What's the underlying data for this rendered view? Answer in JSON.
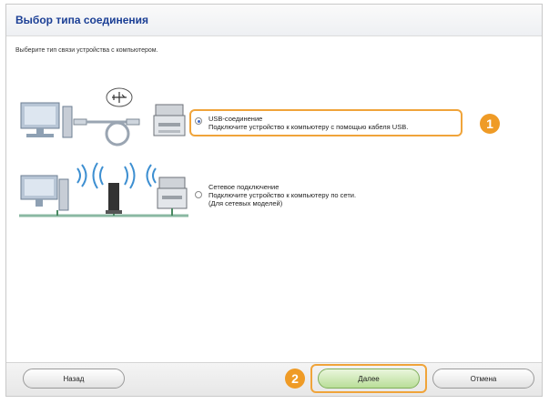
{
  "dialog": {
    "title": "Выбор типа соединения",
    "instruction": "Выберите тип связи устройства с компьютером."
  },
  "options": [
    {
      "title": "USB-соединение",
      "description": "Подключите устройство к компьютеру с помощью кабеля USB.",
      "selected": true,
      "illustration_icon": "computer-usb-printer-icon"
    },
    {
      "title": "Сетевое подключение",
      "description": "Подключите устройство к компьютеру по сети.",
      "note": "(Для сетевых моделей)",
      "selected": false,
      "illustration_icon": "network-wifi-printer-icon"
    }
  ],
  "callouts": [
    "1",
    "2"
  ],
  "buttons": {
    "back": "Назад",
    "next": "Далее",
    "cancel": "Отмена"
  },
  "colors": {
    "title": "#1b3f95",
    "highlight": "#f0a43a",
    "callout": "#ef9b26",
    "next_button": "#b9de98"
  }
}
